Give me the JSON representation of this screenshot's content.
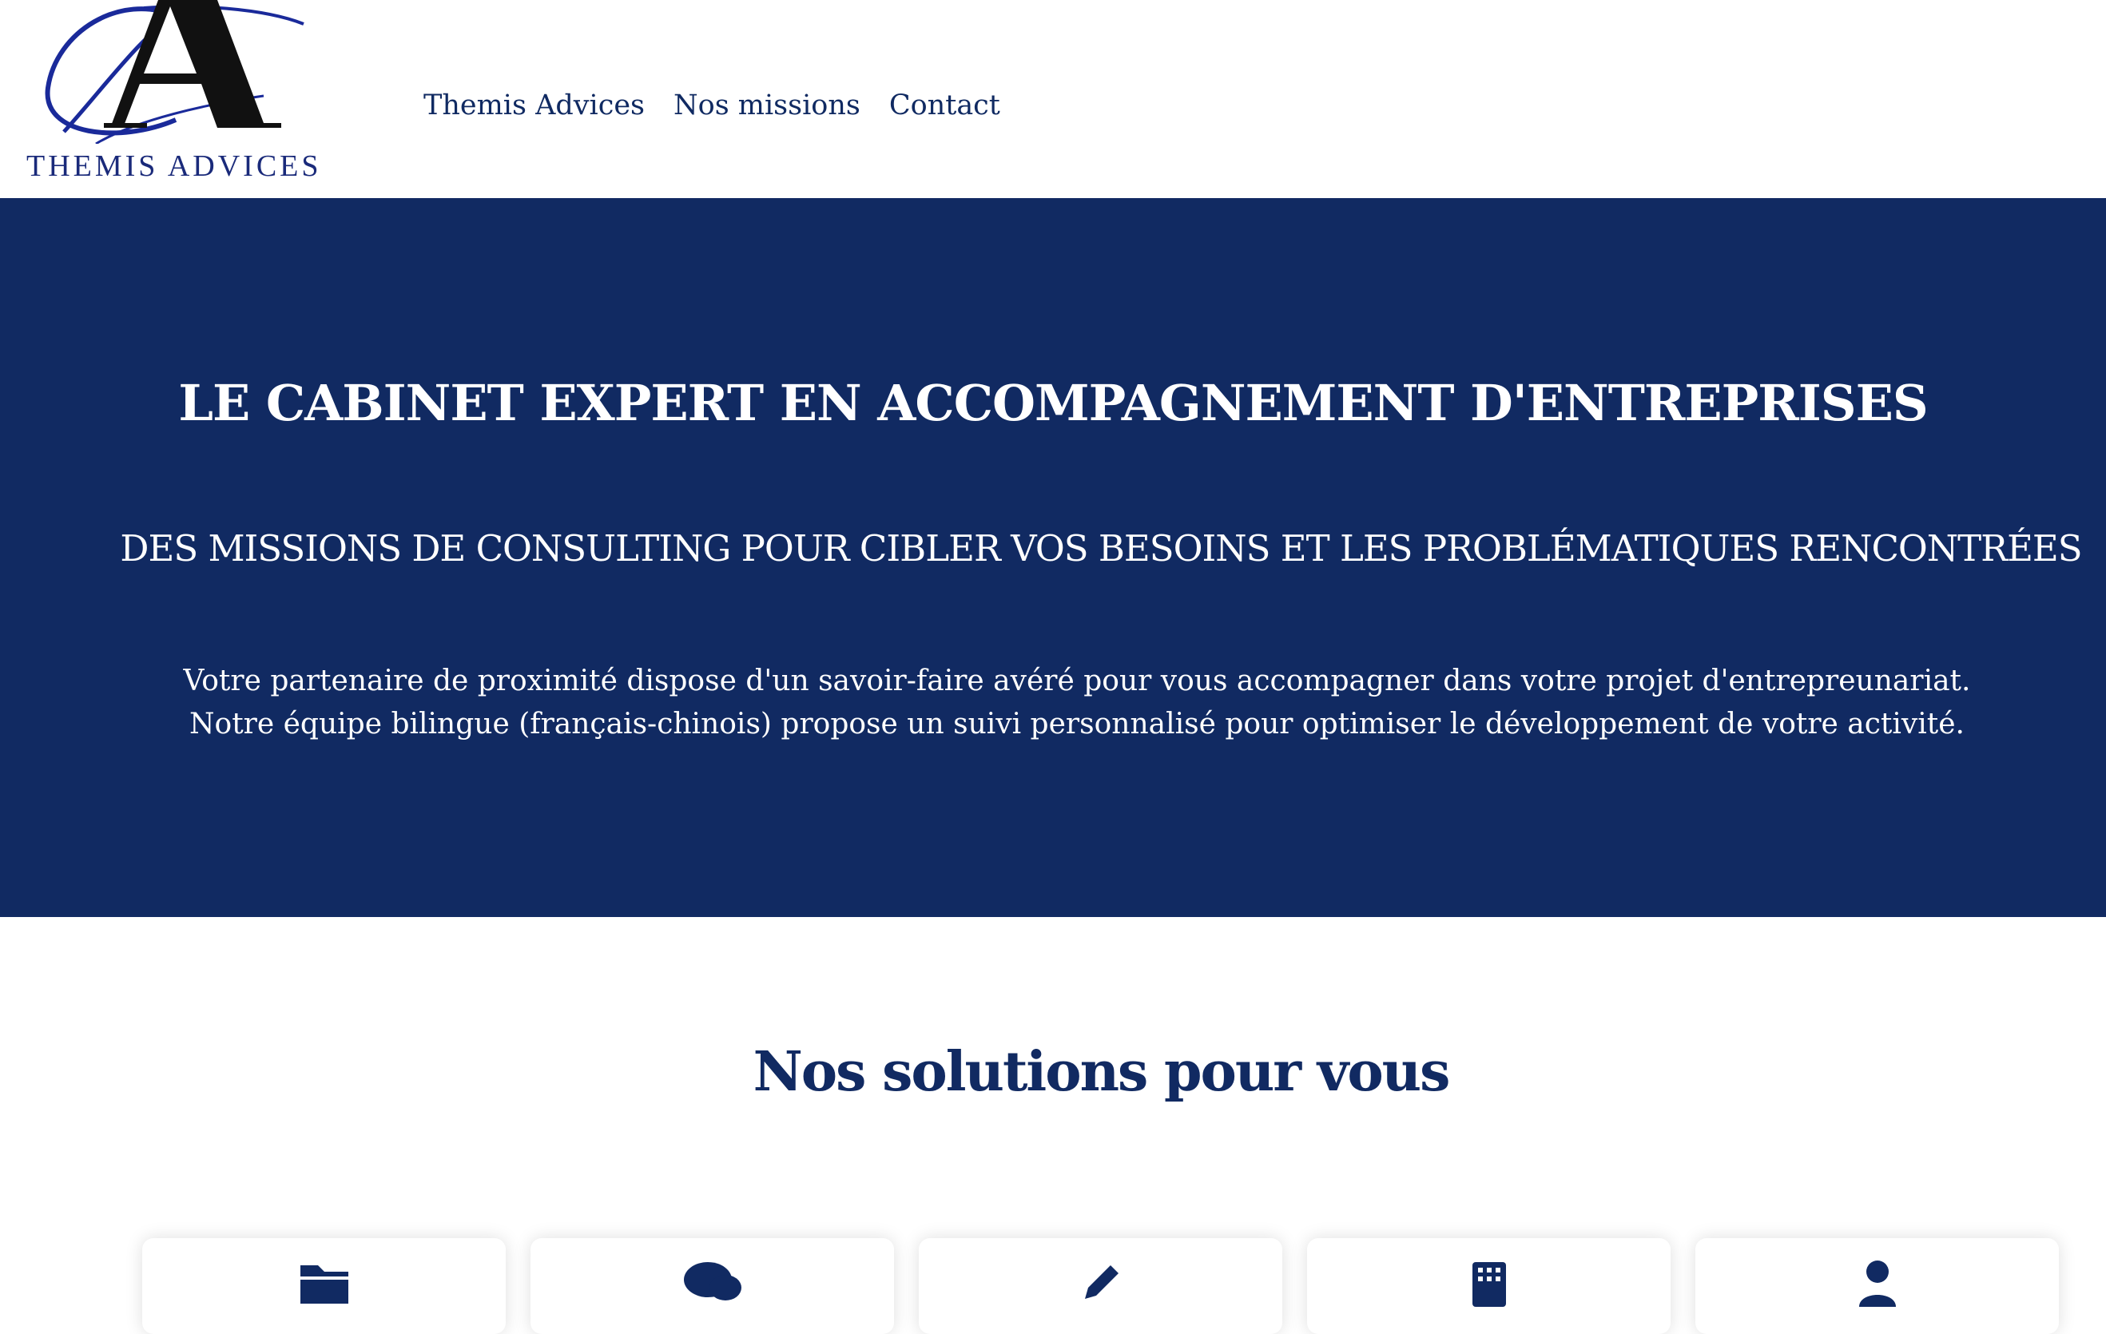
{
  "brand": {
    "logo_text": "THEMIS ADVICES",
    "logo_letter": "A",
    "accent_color": "#1a2a9a",
    "navy_color": "#112a62"
  },
  "nav": {
    "items": [
      {
        "label": "Themis Advices"
      },
      {
        "label": "Nos missions"
      },
      {
        "label": "Contact"
      }
    ]
  },
  "hero": {
    "title": "LE CABINET EXPERT EN ACCOMPAGNEMENT D'ENTREPRISES",
    "subtitle": "DES MISSIONS DE CONSULTING POUR CIBLER VOS BESOINS ET LES PROBLÉMATIQUES RENCONTRÉES",
    "text_line1": "Votre partenaire de proximité dispose d'un savoir-faire avéré pour vous accompagner dans votre projet d'entrepreunariat.",
    "text_line2": "Notre équipe bilingue (français-chinois) propose un suivi personnalisé pour optimiser le développement de votre activité."
  },
  "solutions": {
    "title": "Nos solutions pour vous",
    "cards": [
      {
        "icon": "folder-icon"
      },
      {
        "icon": "comments-icon"
      },
      {
        "icon": "pencil-icon"
      },
      {
        "icon": "building-icon"
      },
      {
        "icon": "user-icon"
      }
    ]
  }
}
